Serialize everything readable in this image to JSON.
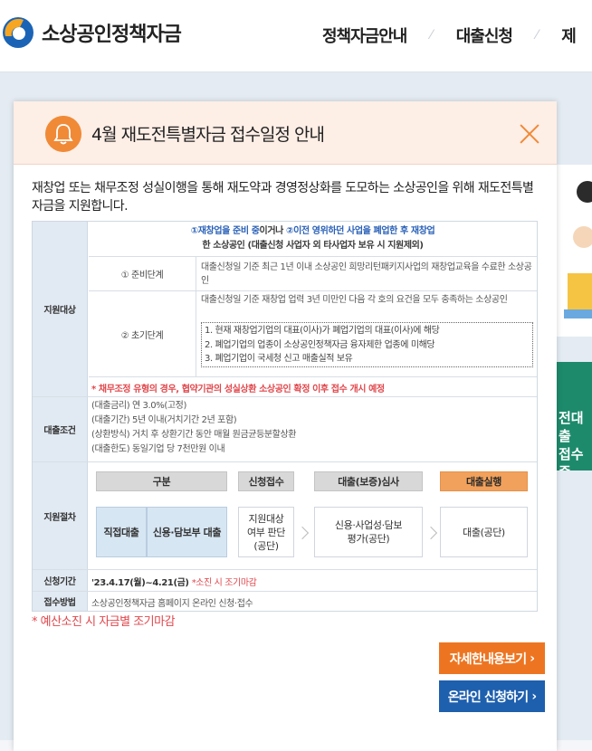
{
  "header": {
    "logo_text": "소상공인정책자금",
    "nav": [
      "정책자금안내",
      "대출신청",
      "제"
    ]
  },
  "background": {
    "side_text": "전대출\n접수중"
  },
  "modal": {
    "title": "4월 재도전특별자금 접수일정 안내",
    "intro": "재창업 또는 채무조정 성실이행을 통해 재도약과 경영정상화를 도모하는 소상공인을 위해 재도전특별자금을 지원합니다.",
    "support_target": {
      "label": "지원대상",
      "head_part1": "①재창업을 준비 중",
      "head_part2": "이거나 ",
      "head_part3": "②이전 영위하던 사업을 폐업한 후 재창업",
      "head_line2": "한 소상공인 (대출신청 사업자 외 타사업자 보유 시 지원제외)",
      "stage1_name": "① 준비단계",
      "stage1_desc": "대출신청일 기준 최근 1년 이내 소상공인 희망리턴패키지사업의 재창업교육을 수료한 소상공인",
      "stage2_name": "② 초기단계",
      "stage2_desc": "대출신청일 기준 재창업 업력 3년 미만인 다음 각 호의 요건을 모두 충족하는 소상공인",
      "stage2_items": [
        "1. 현재 재창업기업의 대표(이사)가 폐업기업의 대표(이사)에 해당",
        "2. 폐업기업의 업종이 소상공인정책자금 융자제한 업종에 미해당",
        "3. 폐업기업이 국세청 신고 매출실적 보유"
      ],
      "note": "* 채무조정 유형의 경우, 협약기관의 성실상환 소상공인 확정 이후 접수 개시 예정"
    },
    "loan_terms": {
      "label": "대출조건",
      "lines": [
        "(대출금리) 연 3.0%(고정)",
        "(대출기간) 5년 이내(거치기간 2년 포함)",
        "(상환방식) 거치 후 상환기간 동안 매월 원금균등분할상환",
        "(대출한도) 동일기업 당 7천만원 이내"
      ]
    },
    "procedure": {
      "label": "지원절차",
      "headers": [
        "구분",
        "신청접수",
        "대출(보증)심사",
        "대출실행"
      ],
      "type_a": "직접대출",
      "type_b": "신용·담보부 대출",
      "step1": "지원대상\n여부 판단\n(공단)",
      "step2": "신용·사업성·담보\n평가(공단)",
      "step3": "대출(공단)"
    },
    "period": {
      "label": "신청기간",
      "value": "'23.4.17(월)~4.21(금)",
      "note": "*소진 시 조기마감"
    },
    "method": {
      "label": "접수방법",
      "value": "소상공인정책자금 홈페이지 온라인 신청·접수"
    },
    "budget_note": "* 예산소진 시 자금별 조기마감",
    "buttons": {
      "detail": "자세한내용보기",
      "online": "온라인 신청하기"
    },
    "colors": {
      "accent_orange": "#ed7521",
      "accent_blue": "#1e5fae",
      "note_red": "#e0474c"
    }
  }
}
